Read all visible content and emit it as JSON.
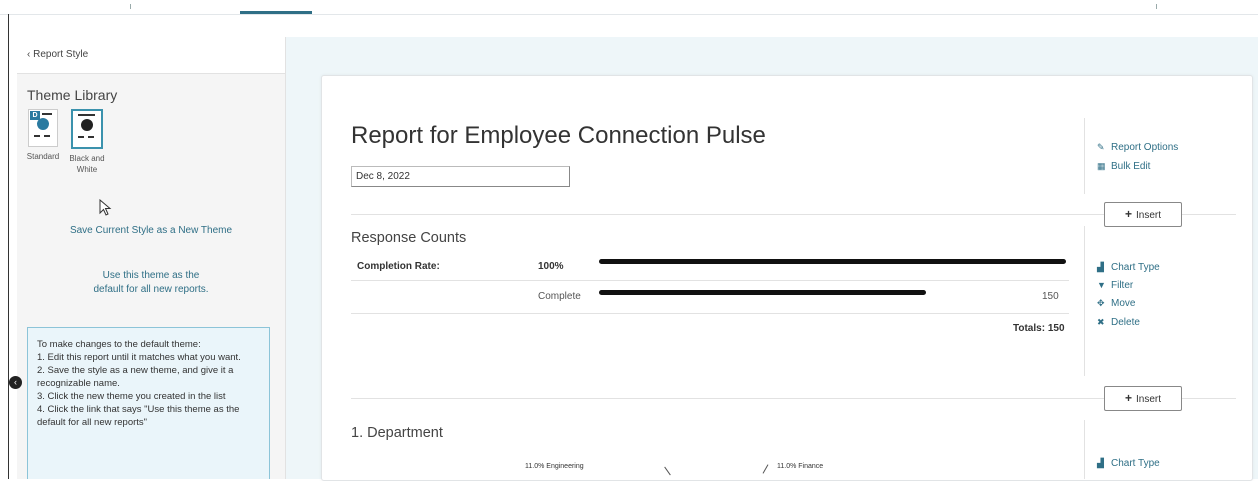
{
  "sidebar": {
    "back_label": "Report Style",
    "theme_library_title": "Theme Library",
    "themes": [
      {
        "label_line1": "Standard",
        "label_line2": "",
        "badge": "D",
        "selected": false
      },
      {
        "label_line1": "Black and",
        "label_line2": "White",
        "badge": "",
        "selected": true
      }
    ],
    "save_theme_link": "Save Current Style as a New Theme",
    "default_theme_link_line1": "Use this theme as the",
    "default_theme_link_line2": "default for all new reports.",
    "info_lines": [
      "To make changes to the default theme:",
      "1. Edit this report until it matches what you want.",
      "2. Save the style as a new theme, and give it a recognizable name.",
      "3. Click the new theme you created in the list",
      "4. Click the link that says \"Use this theme as the default for all new reports\""
    ]
  },
  "report": {
    "title": "Report for Employee Connection Pulse",
    "date": "Dec 8, 2022",
    "options": {
      "report_options": "Report Options",
      "bulk_edit": "Bulk Edit"
    },
    "insert_label": "Insert",
    "section_actions": {
      "chart_type": "Chart Type",
      "filter": "Filter",
      "move": "Move",
      "delete": "Delete"
    },
    "response_counts": {
      "title": "Response Counts",
      "completion_label": "Completion Rate:",
      "completion_value": "100%",
      "completion_fraction": 1.0,
      "rows": [
        {
          "label": "Complete",
          "count": "150",
          "fraction": 0.7
        }
      ],
      "totals": "Totals: 150"
    },
    "department": {
      "title": "1. Department",
      "slice_labels": [
        "11.0% Engineering",
        "11.0% Finance"
      ],
      "chart_type_label": "Chart Type"
    }
  },
  "colors": {
    "accent": "#2f6f86",
    "canvas": "#eef6f9",
    "sidebar": "#f5f5f5",
    "info_bg": "#eaf5fa"
  }
}
